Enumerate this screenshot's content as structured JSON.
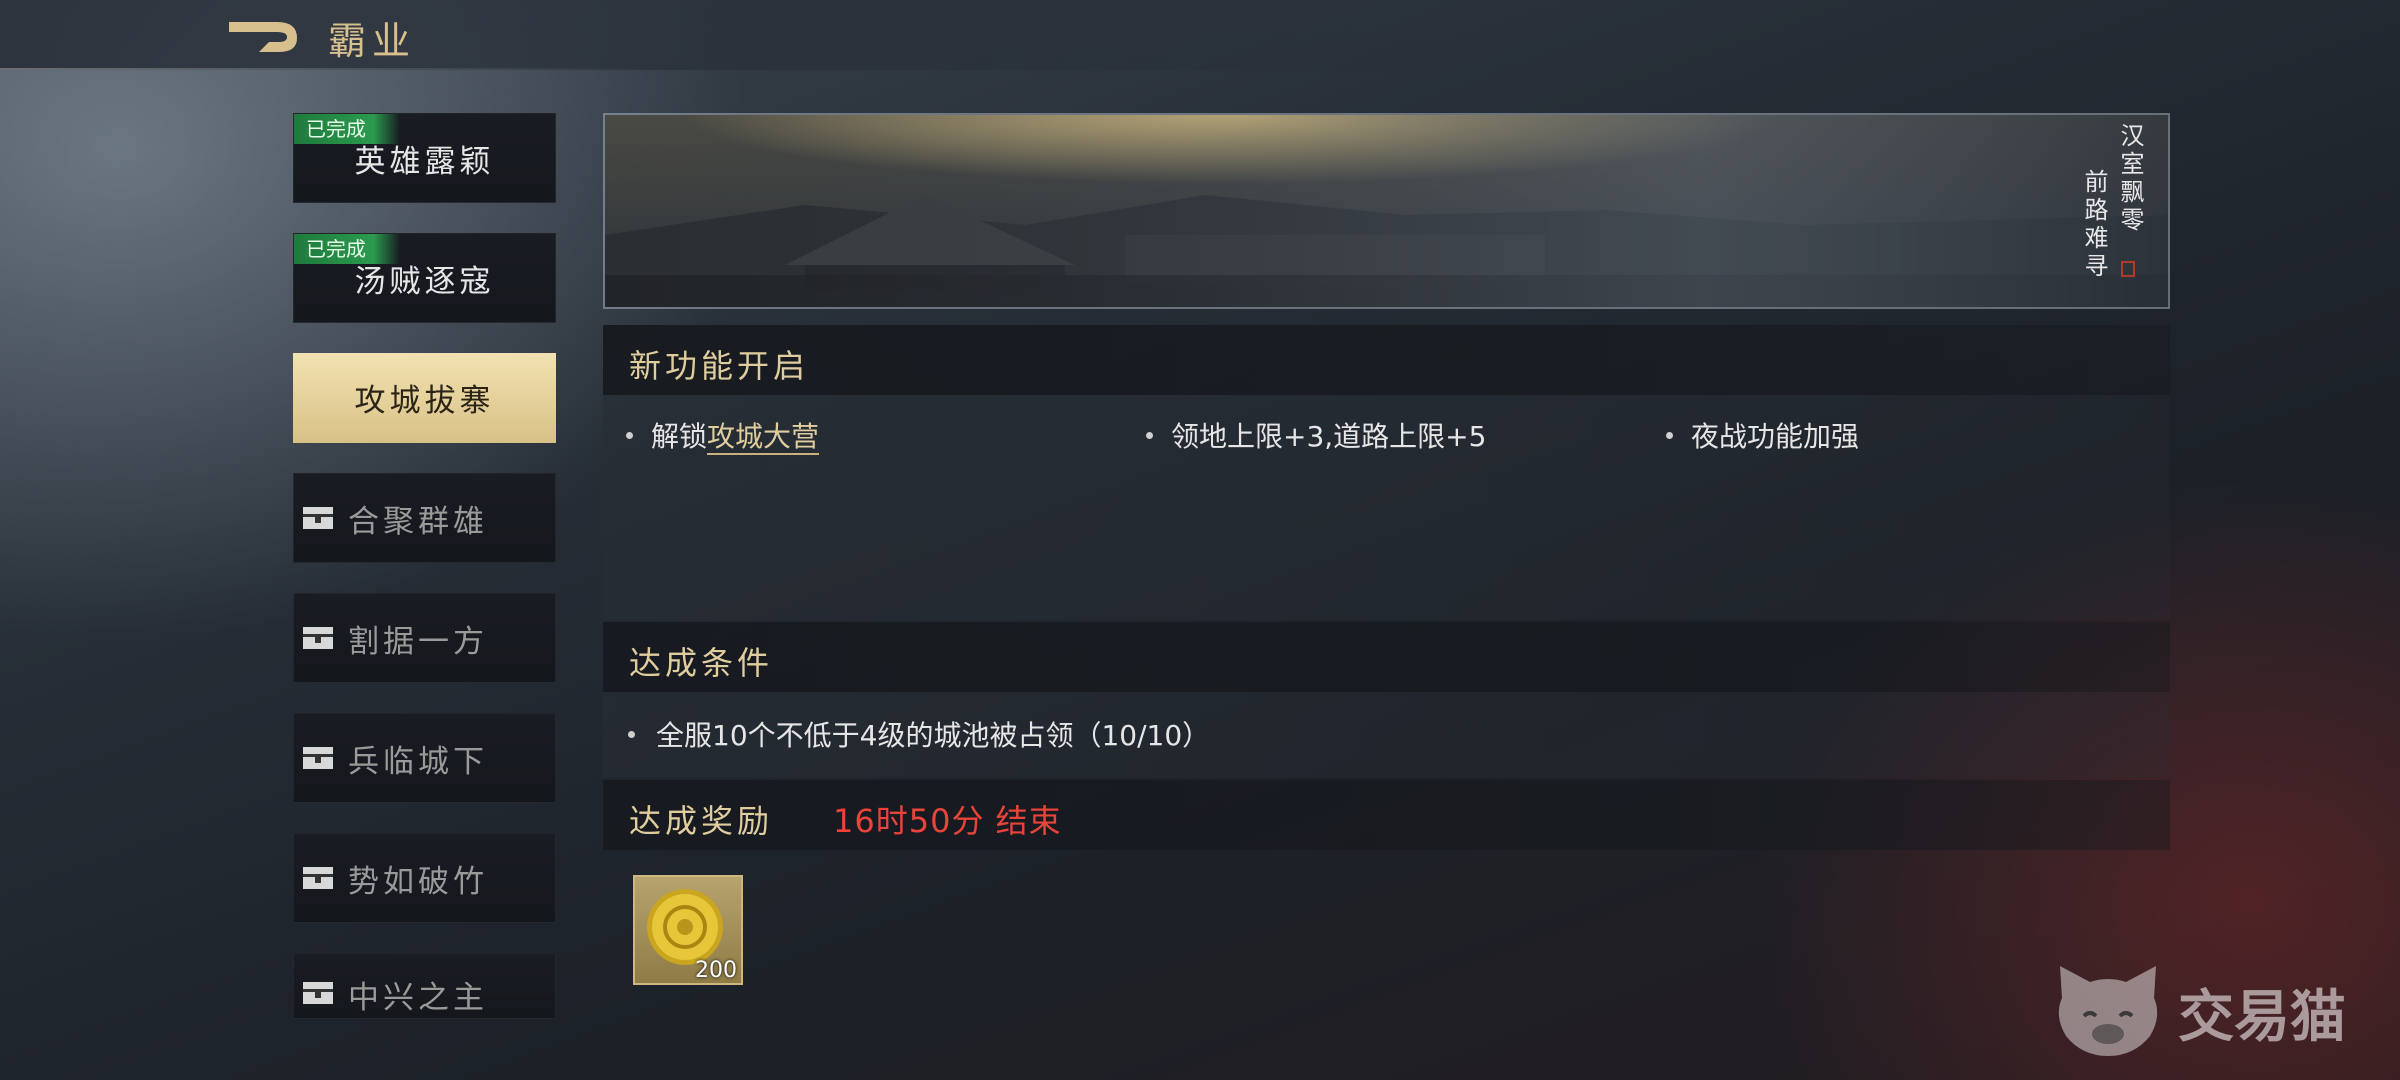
{
  "header": {
    "title": "霸业"
  },
  "sidebar": {
    "items": [
      {
        "label": "英雄露颖",
        "badge": "已完成",
        "state": "done"
      },
      {
        "label": "汤贼逐寇",
        "badge": "已完成",
        "state": "done"
      },
      {
        "label": "攻城拔寨",
        "badge": "",
        "state": "active"
      },
      {
        "label": "合聚群雄",
        "badge": "",
        "state": "locked"
      },
      {
        "label": "割据一方",
        "badge": "",
        "state": "locked"
      },
      {
        "label": "兵临城下",
        "badge": "",
        "state": "locked"
      },
      {
        "label": "势如破竹",
        "badge": "",
        "state": "locked"
      },
      {
        "label": "中兴之主",
        "badge": "",
        "state": "locked"
      }
    ]
  },
  "banner": {
    "poem_line1": "汉室飘零",
    "poem_line2": "前路难寻"
  },
  "features": {
    "title": "新功能开启",
    "item1_prefix": "解锁",
    "item1_link": "攻城大营",
    "item2": "领地上限+3,道路上限+5",
    "item3": "夜战功能加强"
  },
  "conditions": {
    "title": "达成条件",
    "item1": "全服10个不低于4级的城池被占领（10/10）"
  },
  "rewards": {
    "title": "达成奖励",
    "timer": "16时50分 结束",
    "items": [
      {
        "icon": "gold-coin-icon",
        "count": "200"
      }
    ]
  },
  "watermark": {
    "text": "交易猫"
  },
  "colors": {
    "accent_gold": "#e0cd9e",
    "timer_red": "#e8443a",
    "badge_green": "#2b9a4e",
    "active_tab": "#f2e2b2"
  }
}
